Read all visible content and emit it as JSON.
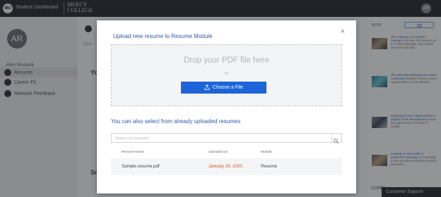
{
  "topbar": {
    "badge": "MU",
    "title": "Student Dashboard",
    "logo_line1": "MERCY",
    "logo_line2": "COLLEGE",
    "avatar": "AR"
  },
  "sidebar": {
    "avatar_initials": "AR",
    "user_name": "Allen Rossetti",
    "items": [
      {
        "label": "Resume"
      },
      {
        "label": "Career Fit"
      },
      {
        "label": "Network Feedback"
      }
    ]
  },
  "main": {
    "faint_text": "Sam",
    "heading_partial": "Yo",
    "heading_partial_2": "Sc"
  },
  "blog": {
    "header": "BLOG",
    "items": [
      {
        "title": "The Anatomy of a Product Manager",
        "excerpt": "Discover the anatomy of a Product Manager and explore diverse functional..."
      },
      {
        "title": "The International Business Career Landscape",
        "excerpt": "Explore the key career opportunities in international..."
      },
      {
        "title": "Exploring Career Opportunities in Supply Chain Management",
        "excerpt": "Seize the opportunity to be part of supply..."
      },
      {
        "title": "Landing An Internship in Investment Banking",
        "excerpt": "An internship in the investment banking industry demands..."
      }
    ],
    "comm_label": "COMM",
    "support_label": "Customer Support"
  },
  "modal": {
    "title": "Upload new resume to Resume Module",
    "close_symbol": "×",
    "dropzone_text": "Drop your PDF file here",
    "or_text": "or",
    "choose_button": "Choose a File",
    "existing_title": "You can also select from already uploaded resumes",
    "search_placeholder": "Search by keyword",
    "table": {
      "headers": [
        "Resume Name",
        "Uploaded on",
        "Module"
      ],
      "rows": [
        {
          "name": "Sample.resume.pdf",
          "uploaded": "January 29, 2020",
          "module": "Resume"
        }
      ]
    }
  },
  "colors": {
    "accent": "#1d64d8",
    "title_blue": "#2f5aa8",
    "date_orange": "#e24d12",
    "topbar": "#2b3035"
  }
}
